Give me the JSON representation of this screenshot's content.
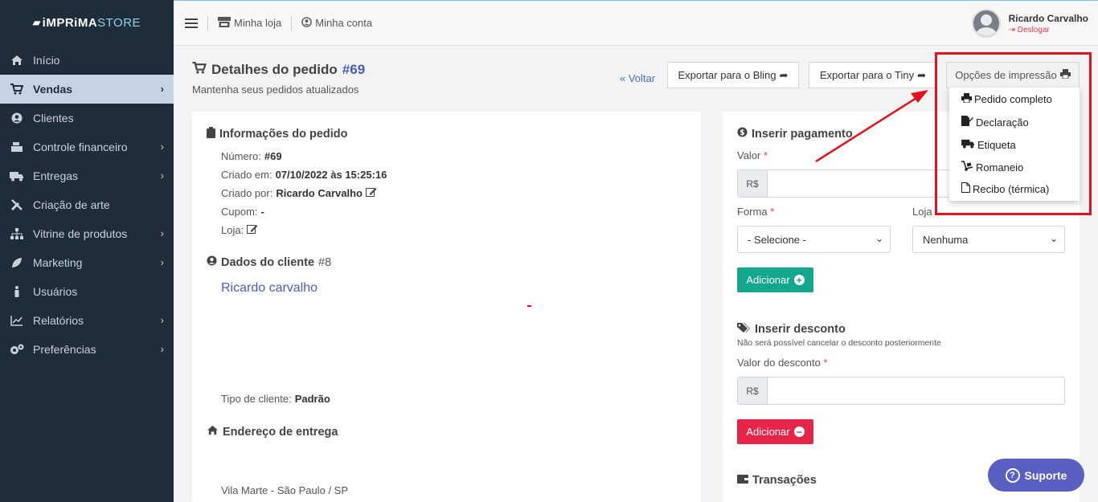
{
  "brand": {
    "part1": "iMPRiMA",
    "part2": "STORE"
  },
  "sidebar": {
    "items": [
      {
        "label": "Início",
        "icon": "home-icon"
      },
      {
        "label": "Vendas",
        "icon": "cart-icon"
      },
      {
        "label": "Clientes",
        "icon": "user-circle-icon"
      },
      {
        "label": "Controle financeiro",
        "icon": "cash-register-icon"
      },
      {
        "label": "Entregas",
        "icon": "truck-icon"
      },
      {
        "label": "Criação de arte",
        "icon": "tools-icon"
      },
      {
        "label": "Vitrine de produtos",
        "icon": "sitemap-icon"
      },
      {
        "label": "Marketing",
        "icon": "leaf-icon"
      },
      {
        "label": "Usuários",
        "icon": "person-icon"
      },
      {
        "label": "Relatórios",
        "icon": "chart-line-icon"
      },
      {
        "label": "Preferências",
        "icon": "gears-icon"
      }
    ]
  },
  "topbar": {
    "minha_loja": "Minha loja",
    "minha_conta": "Minha conta"
  },
  "user": {
    "name": "Ricardo Carvalho",
    "logout": "Deslogar"
  },
  "page": {
    "title": "Detalhes do pedido",
    "order_no": "#69",
    "subtitle": "Mantenha seus pedidos atualizados"
  },
  "actions": {
    "voltar": "« Voltar",
    "bling": "Exportar para o Bling",
    "tiny": "Exportar para o Tiny",
    "print": "Opções de impressão"
  },
  "print_menu": [
    "Pedido completo",
    "Declaração",
    "Etiqueta",
    "Romaneio",
    "Recibo (térmica)"
  ],
  "order_info": {
    "title": "Informações do pedido",
    "numero_label": "Número:",
    "numero": "#69",
    "criado_em_label": "Criado em:",
    "criado_em": "07/10/2022 às 15:25:16",
    "criado_por_label": "Criado por:",
    "criado_por": "Ricardo Carvalho",
    "cupom_label": "Cupom:",
    "cupom": "-",
    "loja_label": "Loja:"
  },
  "client": {
    "title": "Dados do cliente",
    "id": "#8",
    "name": "Ricardo carvalho",
    "tipo_label": "Tipo de cliente:",
    "tipo": "Padrão"
  },
  "address": {
    "title": "Endereço de entrega",
    "line": "Vila Marte - São Paulo / SP"
  },
  "payment": {
    "title": "Inserir pagamento",
    "valor_label": "Valor",
    "currency": "R$",
    "forma_label": "Forma",
    "forma_value": "- Selecione -",
    "loja_label": "Loja",
    "loja_value": "Nenhuma",
    "add": "Adicionar"
  },
  "discount": {
    "title": "Inserir desconto",
    "note": "Não será possível cancelar o desconto posteriormente",
    "valor_label": "Valor do desconto",
    "currency": "R$",
    "add": "Adicionar"
  },
  "transactions": {
    "title": "Transações"
  },
  "support": {
    "label": "Suporte"
  },
  "colors": {
    "sidebar": "#1f2d3a",
    "accent": "#4a5cb8",
    "green": "#15a78e",
    "red": "#e5264a",
    "highlight": "#e5121d"
  }
}
